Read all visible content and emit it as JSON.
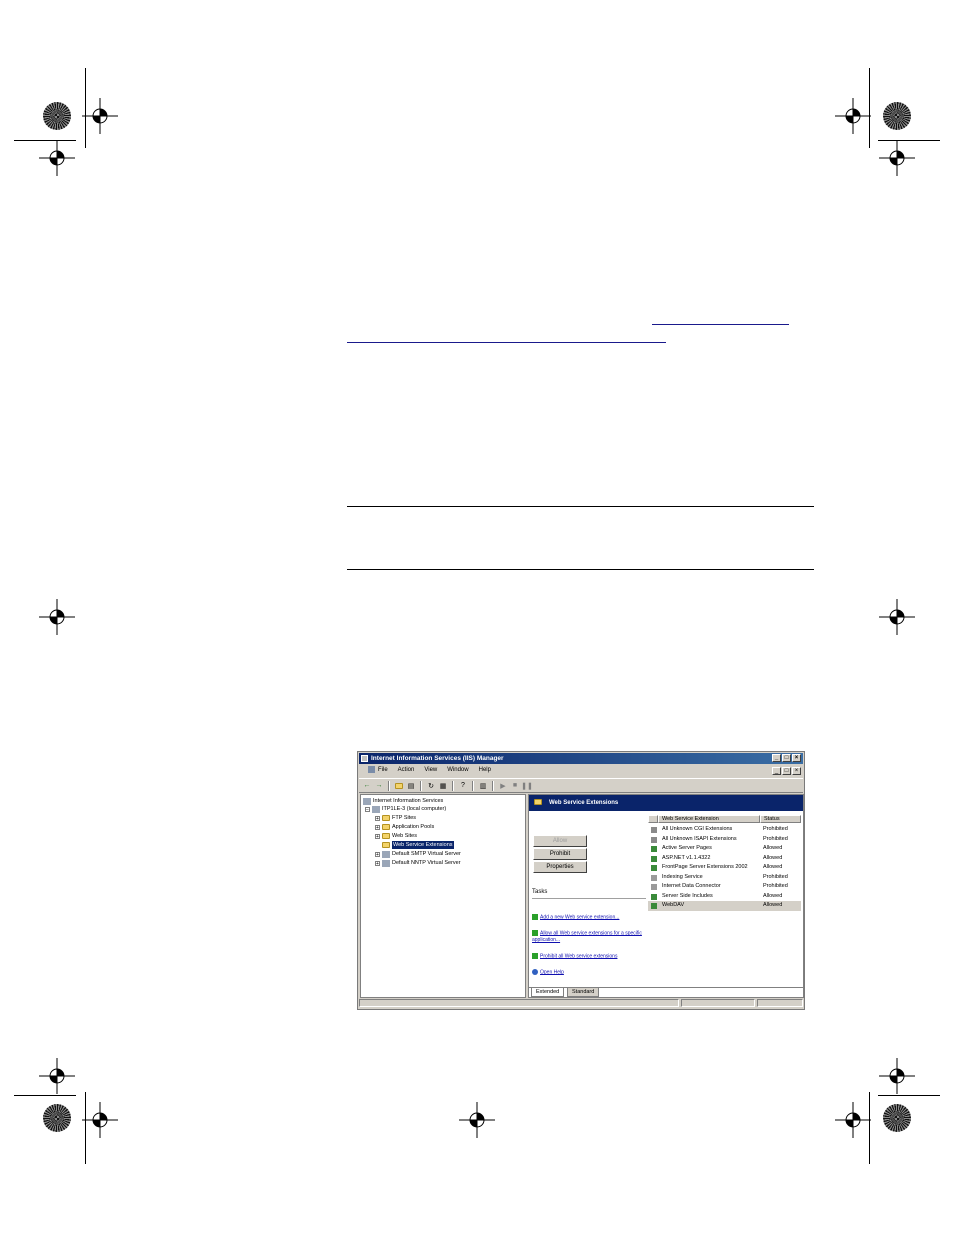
{
  "window": {
    "title": "Internet Information Services (IIS) Manager",
    "controls": {
      "minimize": "_",
      "maximize": "□",
      "close": "×"
    }
  },
  "menu": [
    "File",
    "Action",
    "View",
    "Window",
    "Help"
  ],
  "toolbar_icons": [
    "back-icon",
    "forward-icon",
    "up-folder-icon",
    "show-tree-icon",
    "refresh-icon",
    "export-icon",
    "properties-icon",
    "help-icon",
    "play-icon",
    "stop-icon",
    "pause-icon"
  ],
  "tree": {
    "root": "Internet Information Services",
    "computer": "ITP1LE-3 (local computer)",
    "items": [
      "FTP Sites",
      "Application Pools",
      "Web Sites",
      "Web Service Extensions",
      "Default SMTP Virtual Server",
      "Default NNTP Virtual Server"
    ]
  },
  "panel": {
    "header": "Web Service Extensions",
    "buttons": {
      "allow": "Allow",
      "prohibit": "Prohibit",
      "properties": "Properties"
    },
    "tasks_label": "Tasks",
    "tasks": [
      "Add a new Web service extension...",
      "Allow all Web service extensions for a specific application...",
      "Prohibit all Web service extensions",
      "Open Help"
    ],
    "columns": {
      "name": "Web Service Extension",
      "status": "Status"
    },
    "rows": [
      {
        "name": "All Unknown CGI Extensions",
        "status": "Prohibited"
      },
      {
        "name": "All Unknown ISAPI Extensions",
        "status": "Prohibited"
      },
      {
        "name": "Active Server Pages",
        "status": "Allowed"
      },
      {
        "name": "ASP.NET v1.1.4322",
        "status": "Allowed"
      },
      {
        "name": "FrontPage Server Extensions 2002",
        "status": "Allowed"
      },
      {
        "name": "Indexing Service",
        "status": "Prohibited"
      },
      {
        "name": "Internet Data Connector",
        "status": "Prohibited"
      },
      {
        "name": "Server Side Includes",
        "status": "Allowed"
      },
      {
        "name": "WebDAV",
        "status": "Allowed"
      }
    ],
    "tabs": {
      "extended": "Extended",
      "standard": "Standard"
    }
  },
  "colors": {
    "title_bar": "#0a246a",
    "header": "#0a246a",
    "link": "#1010b0"
  }
}
